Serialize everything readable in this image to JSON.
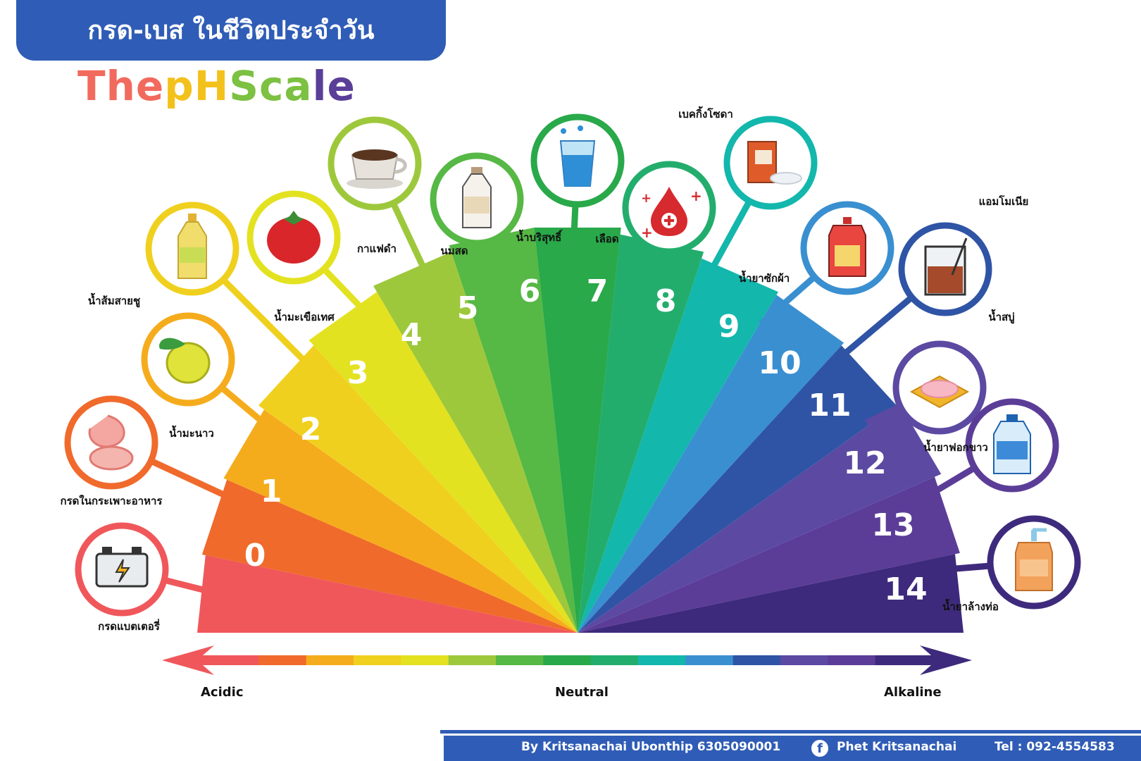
{
  "header": {
    "banner_title": "กรด-เบส ในชีวิตประจำวัน",
    "title_parts": [
      {
        "text": "The",
        "color": "#f26a5e"
      },
      {
        "text": " ",
        "color": "#ffffff"
      },
      {
        "text": "pH",
        "color": "#f3c11c"
      },
      {
        "text": " ",
        "color": "#ffffff"
      },
      {
        "text": "Sca",
        "color": "#7cc142"
      },
      {
        "text": "le",
        "color": "#5a3f98"
      }
    ]
  },
  "scale": {
    "levels": [
      {
        "ph": "0",
        "label": "กรดแบตเตอรี่",
        "icon": "battery-icon",
        "color": "#f0575b"
      },
      {
        "ph": "1",
        "label": "กรดในกระเพาะอาหาร",
        "icon": "stomach-icon",
        "color": "#f06a2c"
      },
      {
        "ph": "2",
        "label": "น้ำมะนาว",
        "icon": "lemon-icon",
        "color": "#f5ac1c"
      },
      {
        "ph": "3",
        "label": "น้ำส้มสายชู",
        "icon": "vinegar-bottle-icon",
        "color": "#f0d01e"
      },
      {
        "ph": "4",
        "label": "น้ำมะเขือเทศ",
        "icon": "tomato-icon",
        "color": "#e3e221"
      },
      {
        "ph": "5",
        "label": "กาแฟดำ",
        "icon": "coffee-cup-icon",
        "color": "#9ec83c"
      },
      {
        "ph": "6",
        "label": "นมสด",
        "icon": "milk-bottle-icon",
        "color": "#56b845"
      },
      {
        "ph": "7",
        "label": "น้ำบริสุทธิ์",
        "icon": "water-glass-icon",
        "color": "#29a94a"
      },
      {
        "ph": "8",
        "label": "เลือด",
        "icon": "blood-drop-icon",
        "color": "#23ad6d"
      },
      {
        "ph": "9",
        "label": "เบคกิ้งโซดา",
        "icon": "baking-soda-icon",
        "color": "#13b7ac"
      },
      {
        "ph": "10",
        "label": "น้ำยาซักผ้า",
        "icon": "detergent-icon",
        "color": "#3a8fd0"
      },
      {
        "ph": "11",
        "label": "แอมโมเนีย",
        "icon": "beaker-icon",
        "color": "#2f54a5"
      },
      {
        "ph": "12",
        "label": "น้ำสบู่",
        "icon": "soap-icon",
        "color": "#5c49a2"
      },
      {
        "ph": "13",
        "label": "น้ำยาฟอกขาว",
        "icon": "bleach-bottle-icon",
        "color": "#5b3d98"
      },
      {
        "ph": "14",
        "label": "น้ำยาล้างท่อ",
        "icon": "drain-cleaner-icon",
        "color": "#3e2a7c"
      }
    ]
  },
  "axis": {
    "left_label": "Acidic",
    "center_label": "Neutral",
    "right_label": "Alkaline"
  },
  "footer": {
    "author": "By Kritsanachai Ubonthip 6305090001",
    "facebook": "Phet Kritsanachai",
    "phone": "Tel : 092-4554583"
  }
}
